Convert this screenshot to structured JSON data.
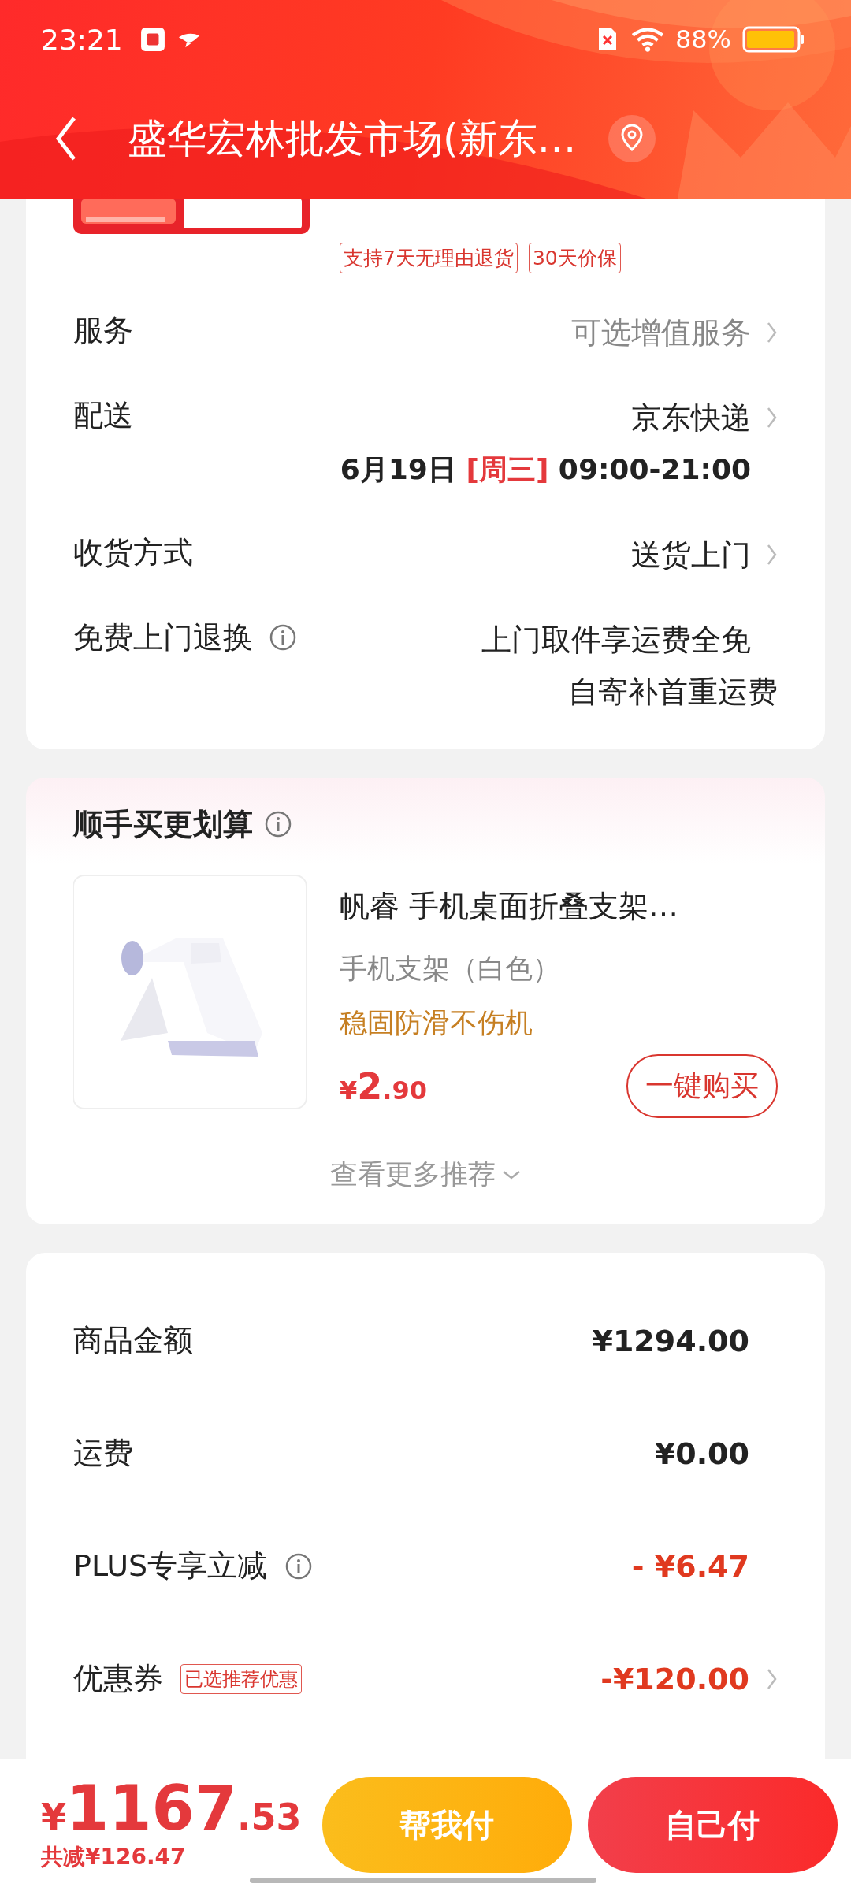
{
  "status_bar": {
    "time": "23:21",
    "battery": "88%"
  },
  "header": {
    "title": "盛华宏林批发市场(新东…"
  },
  "product": {
    "tags": [
      "支持7天无理由退货",
      "30天价保"
    ]
  },
  "details": [
    {
      "label": "服务",
      "lines": [
        "可选增值服务"
      ],
      "muted": true,
      "chevron": true,
      "info": false
    },
    {
      "label": "配送",
      "lines": [
        "京东快递"
      ],
      "muted": false,
      "chevron": true,
      "info": false,
      "schedule": {
        "date": "6月19日",
        "weekday": "[周三]",
        "time": "09:00-21:00"
      }
    },
    {
      "label": "收货方式",
      "lines": [
        "送货上门"
      ],
      "muted": false,
      "chevron": true,
      "info": false
    },
    {
      "label": "免费上门退换",
      "lines": [
        "上门取件享运费全免",
        "自寄补首重运费"
      ],
      "muted": false,
      "chevron": false,
      "info": true
    }
  ],
  "recommend": {
    "title": "顺手买更划算",
    "item": {
      "name": "帆睿 手机桌面折叠支架…",
      "spec": "手机支架（白色）",
      "promo": "稳固防滑不伤机",
      "price": {
        "symbol": "¥",
        "integer": "2",
        "decimal": ".90"
      },
      "button": "一键购买"
    },
    "more": "查看更多推荐"
  },
  "summary": [
    {
      "label": "商品金额",
      "value": "¥1294.00",
      "discount": false,
      "info": false,
      "chevron": false
    },
    {
      "label": "运费",
      "value": "¥0.00",
      "discount": false,
      "info": false,
      "chevron": false
    },
    {
      "label": "PLUS专享立减",
      "value": "- ¥6.47",
      "discount": true,
      "info": true,
      "chevron": false
    },
    {
      "label": "优惠券",
      "badge": "已选推荐优惠",
      "value": "-¥120.00",
      "discount": true,
      "info": false,
      "chevron": true
    }
  ],
  "checkout": {
    "total": {
      "symbol": "¥",
      "integer": "1167",
      "decimal": ".53"
    },
    "saved": "共减¥126.47",
    "buttons": [
      {
        "label": "帮我付",
        "kind": "friend"
      },
      {
        "label": "自己付",
        "kind": "self"
      }
    ]
  }
}
